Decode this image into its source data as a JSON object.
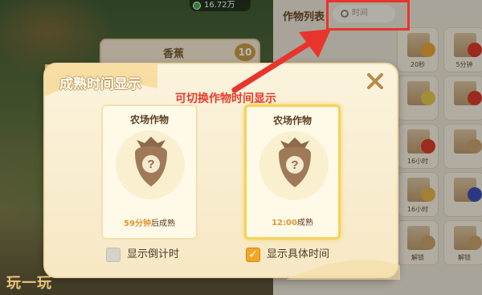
{
  "hud": {
    "currency_value": "16.72万"
  },
  "background_item": {
    "name": "香蕉",
    "count": "10"
  },
  "crop_panel": {
    "title": "作物列表",
    "sort_label": "时间",
    "cells": [
      {
        "time": "20秒",
        "fruit_color": "#e9a23b"
      },
      {
        "time": "5分钟",
        "fruit_color": "#d83b2b"
      },
      {
        "time": "",
        "fruit_color": "#e2c54a"
      },
      {
        "time": "",
        "fruit_color": "#d83b2b"
      },
      {
        "time": "16小时",
        "fruit_color": "#d83b2b"
      },
      {
        "time": "",
        "fruit_color": "#c9a06b"
      },
      {
        "time": "16小时",
        "fruit_color": "#e1b24a"
      },
      {
        "time": "",
        "fruit_color": "#3b4fb0"
      },
      {
        "time": "解锁",
        "fruit_color": "#c9a06b"
      },
      {
        "time": "解锁",
        "fruit_color": "#c9a06b"
      }
    ]
  },
  "annotation": {
    "text": "可切换作物时间显示"
  },
  "dialog": {
    "title": "成熟时间显示",
    "cards": [
      {
        "title": "农场作物",
        "value": "59分钟",
        "suffix": "后成熟",
        "selected": false
      },
      {
        "title": "农场作物",
        "value": "12:00",
        "suffix": "成熟",
        "selected": true
      }
    ],
    "options": [
      {
        "label": "显示倒计时",
        "checked": false
      },
      {
        "label": "显示具体时间",
        "checked": true
      }
    ]
  },
  "watermark": "玩一玩",
  "colors": {
    "accent": "#f2a628",
    "annotation": "#e83a2a",
    "dialog_bg": "#fbf3dd"
  }
}
